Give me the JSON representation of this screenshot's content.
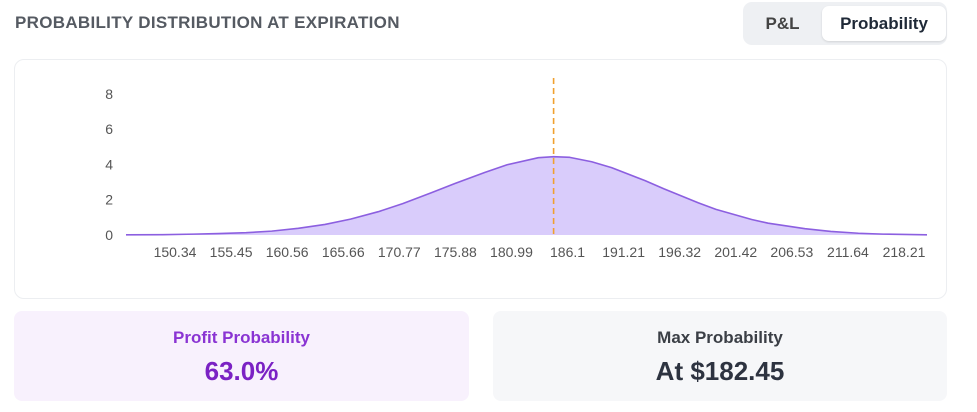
{
  "header": {
    "title": "PROBABILITY DISTRIBUTION AT EXPIRATION"
  },
  "toggle": {
    "options": [
      {
        "label": "P&L",
        "active": false
      },
      {
        "label": "Probability",
        "active": true
      }
    ]
  },
  "chart_data": {
    "type": "area",
    "x_tick_labels": [
      "150.34",
      "155.45",
      "160.56",
      "165.66",
      "170.77",
      "175.88",
      "180.99",
      "186.1",
      "191.21",
      "196.32",
      "201.42",
      "206.53",
      "211.64",
      "218.21"
    ],
    "y_tick_labels": [
      "0",
      "2",
      "4",
      "6",
      "8"
    ],
    "ylim": [
      0,
      8.5
    ],
    "xlim": [
      141.5,
      218.21
    ],
    "series": [
      {
        "x": [
          141.5,
          145,
          148,
          150.34,
          153,
          155.45,
          158,
          160.56,
          163,
          165.66,
          168,
          170.77,
          173,
          175.88,
          178,
          180.99,
          182.45,
          184,
          186.1,
          188,
          191.21,
          193,
          196.32,
          198,
          201.42,
          203,
          206.53,
          209,
          211.64,
          214,
          218.21
        ],
        "y": [
          0.01,
          0.02,
          0.05,
          0.08,
          0.13,
          0.22,
          0.38,
          0.6,
          0.9,
          1.32,
          1.78,
          2.4,
          2.92,
          3.55,
          3.98,
          4.38,
          4.44,
          4.4,
          4.15,
          3.82,
          3.08,
          2.62,
          1.82,
          1.45,
          0.88,
          0.67,
          0.36,
          0.2,
          0.1,
          0.05,
          0.01
        ]
      }
    ],
    "reference_line": {
      "x": 182.45,
      "style": "dashed",
      "color": "#f0a030"
    },
    "colors": {
      "fill": "#d9ccfb",
      "line": "#8c5fe0"
    },
    "grid": false,
    "legend": "none"
  },
  "stats": {
    "profit": {
      "label": "Profit Probability",
      "value": "63.0%"
    },
    "max": {
      "label": "Max Probability",
      "value": "At $182.45"
    }
  }
}
